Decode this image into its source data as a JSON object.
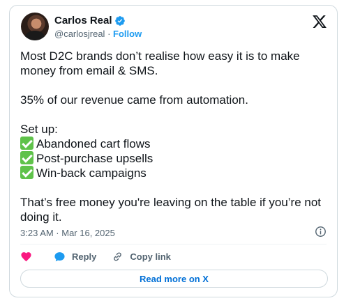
{
  "author": {
    "name": "Carlos Real",
    "handle": "@carlosjreal",
    "separator": "·",
    "follow_label": "Follow"
  },
  "tweet": {
    "line1": "Most D2C brands don’t realise how easy it is to make money from email & SMS.",
    "line2": "35% of our revenue came from automation.",
    "setup_heading": "Set up:",
    "items": [
      "Abandoned cart flows",
      "Post-purchase upsells",
      "Win-back campaigns"
    ],
    "closing": "That’s free money you're leaving on the table if you’re not doing it."
  },
  "timestamp": "3:23 AM · Mar 16, 2025",
  "actions": {
    "reply_label": "Reply",
    "copy_link_label": "Copy link"
  },
  "read_more_label": "Read more on X",
  "icons": {
    "verified": "verified-badge-icon",
    "logo": "x-logo-icon",
    "info": "info-icon",
    "like": "heart-icon",
    "reply": "speech-bubble-icon",
    "copy": "link-icon",
    "check": "check-mark-icon"
  },
  "colors": {
    "accent": "#1d9bf0",
    "heart": "#f91880",
    "check": "#5fc24a",
    "read_more": "#006fd6"
  }
}
